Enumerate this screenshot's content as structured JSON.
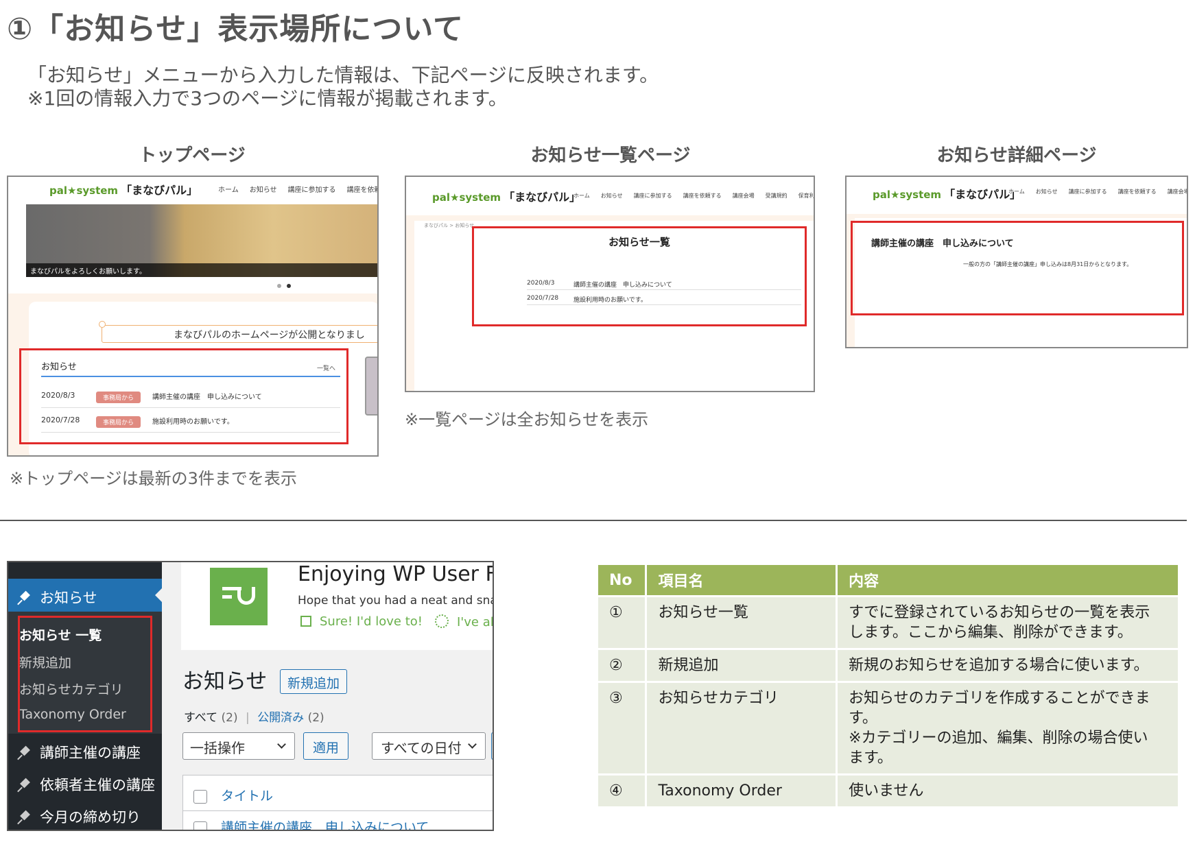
{
  "heading": "①「お知らせ」表示場所について",
  "intro": {
    "line1": "「お知らせ」メニューから入力した情報は、下記ページに反映されます。",
    "line2": "※1回の情報入力で3つのページに情報が掲載されます。"
  },
  "screens": {
    "top": {
      "caption": "トップページ",
      "note": "※トップページは最新の3件までを表示",
      "logo": "pal★system",
      "logo_sub": "「まなびパル」",
      "nav": [
        "ホーム",
        "お知らせ",
        "講座に参加する",
        "講座を依頼"
      ],
      "banner_text": "まなびパルをよろしくお願いします。",
      "announce": "まなびパルのホームページが公開となりまし",
      "news_title": "お知らせ",
      "news_more": "一覧へ",
      "news": [
        {
          "date": "2020/8/3",
          "tag": "事務局から",
          "text": "講師主催の講座　申し込みについて"
        },
        {
          "date": "2020/7/28",
          "tag": "事務局から",
          "text": "施設利用時のお願いです。"
        }
      ]
    },
    "list": {
      "caption": "お知らせ一覧ページ",
      "note": "※一覧ページは全お知らせを表示",
      "logo": "pal★system",
      "logo_sub": "「まなびパル」",
      "nav": [
        "ホーム",
        "お知らせ",
        "講座に参加する",
        "講座を依頼する",
        "講座会場",
        "受講規約",
        "保育利用"
      ],
      "breadcrumb": "まなびパル > お知らせ",
      "page_title": "お知らせ一覧",
      "rows": [
        {
          "date": "2020/8/3",
          "text": "講師主催の講座　申し込みについて"
        },
        {
          "date": "2020/7/28",
          "text": "施設利用時のお願いです。"
        }
      ]
    },
    "detail": {
      "caption": "お知らせ詳細ページ",
      "logo": "pal★system",
      "logo_sub": "「まなびパル」",
      "nav": [
        "ホーム",
        "お知らせ",
        "講座に参加する",
        "講座を依頼する",
        "講座会場"
      ],
      "post_title": "講師主催の講座　申し込みについて",
      "post_body": "一般の方の「講師主催の講座」申し込みは8月31日からとなります。"
    }
  },
  "wp": {
    "menu_current": "お知らせ",
    "submenu": [
      "お知らせ 一覧",
      "新規追加",
      "お知らせカテゴリ",
      "Taxonomy Order"
    ],
    "menu_items": [
      "講師主催の講座",
      "依頼者主催の講座",
      "今月の締め切り"
    ],
    "promo_title": "Enjoying WP User F",
    "promo_text": "Hope that you had a neat and sna",
    "promo_yes": "Sure! I'd love to!",
    "promo_other": "I've al",
    "page_title": "お知らせ",
    "add_new": "新規追加",
    "filter_all": "すべて",
    "filter_all_count": "(2)",
    "filter_sep": "|",
    "filter_published": "公開済み",
    "filter_published_count": "(2)",
    "bulk_action": "一括操作",
    "apply": "適用",
    "all_dates": "すべての日付",
    "col_title": "タイトル",
    "first_post": "講師主催の講座　申し込みについて"
  },
  "table": {
    "headers": [
      "No",
      "項目名",
      "内容"
    ],
    "rows": [
      {
        "no": "①",
        "name": "お知らせ一覧",
        "desc1": "すでに登録されているお知らせの一覧を表示",
        "desc2": "します。ここから編集、削除ができます。",
        "desc3": "",
        "desc4": ""
      },
      {
        "no": "②",
        "name": "新規追加",
        "desc1": "新規のお知らせを追加する場合に使います。",
        "desc2": "",
        "desc3": "",
        "desc4": ""
      },
      {
        "no": "③",
        "name": "お知らせカテゴリ",
        "desc1": "お知らせのカテゴリを作成することができま",
        "desc2": "す。",
        "desc3": "※カテゴリーの追加、編集、削除の場合使い",
        "desc4": "ます。"
      },
      {
        "no": "④",
        "name": "Taxonomy Order",
        "desc1": "使いません",
        "desc2": "",
        "desc3": "",
        "desc4": ""
      }
    ]
  },
  "colors": {
    "highlight_red": "#e02a2a",
    "wp_blue": "#2271b1",
    "table_header": "#9cb55a",
    "table_cell": "#e8ecdf"
  }
}
